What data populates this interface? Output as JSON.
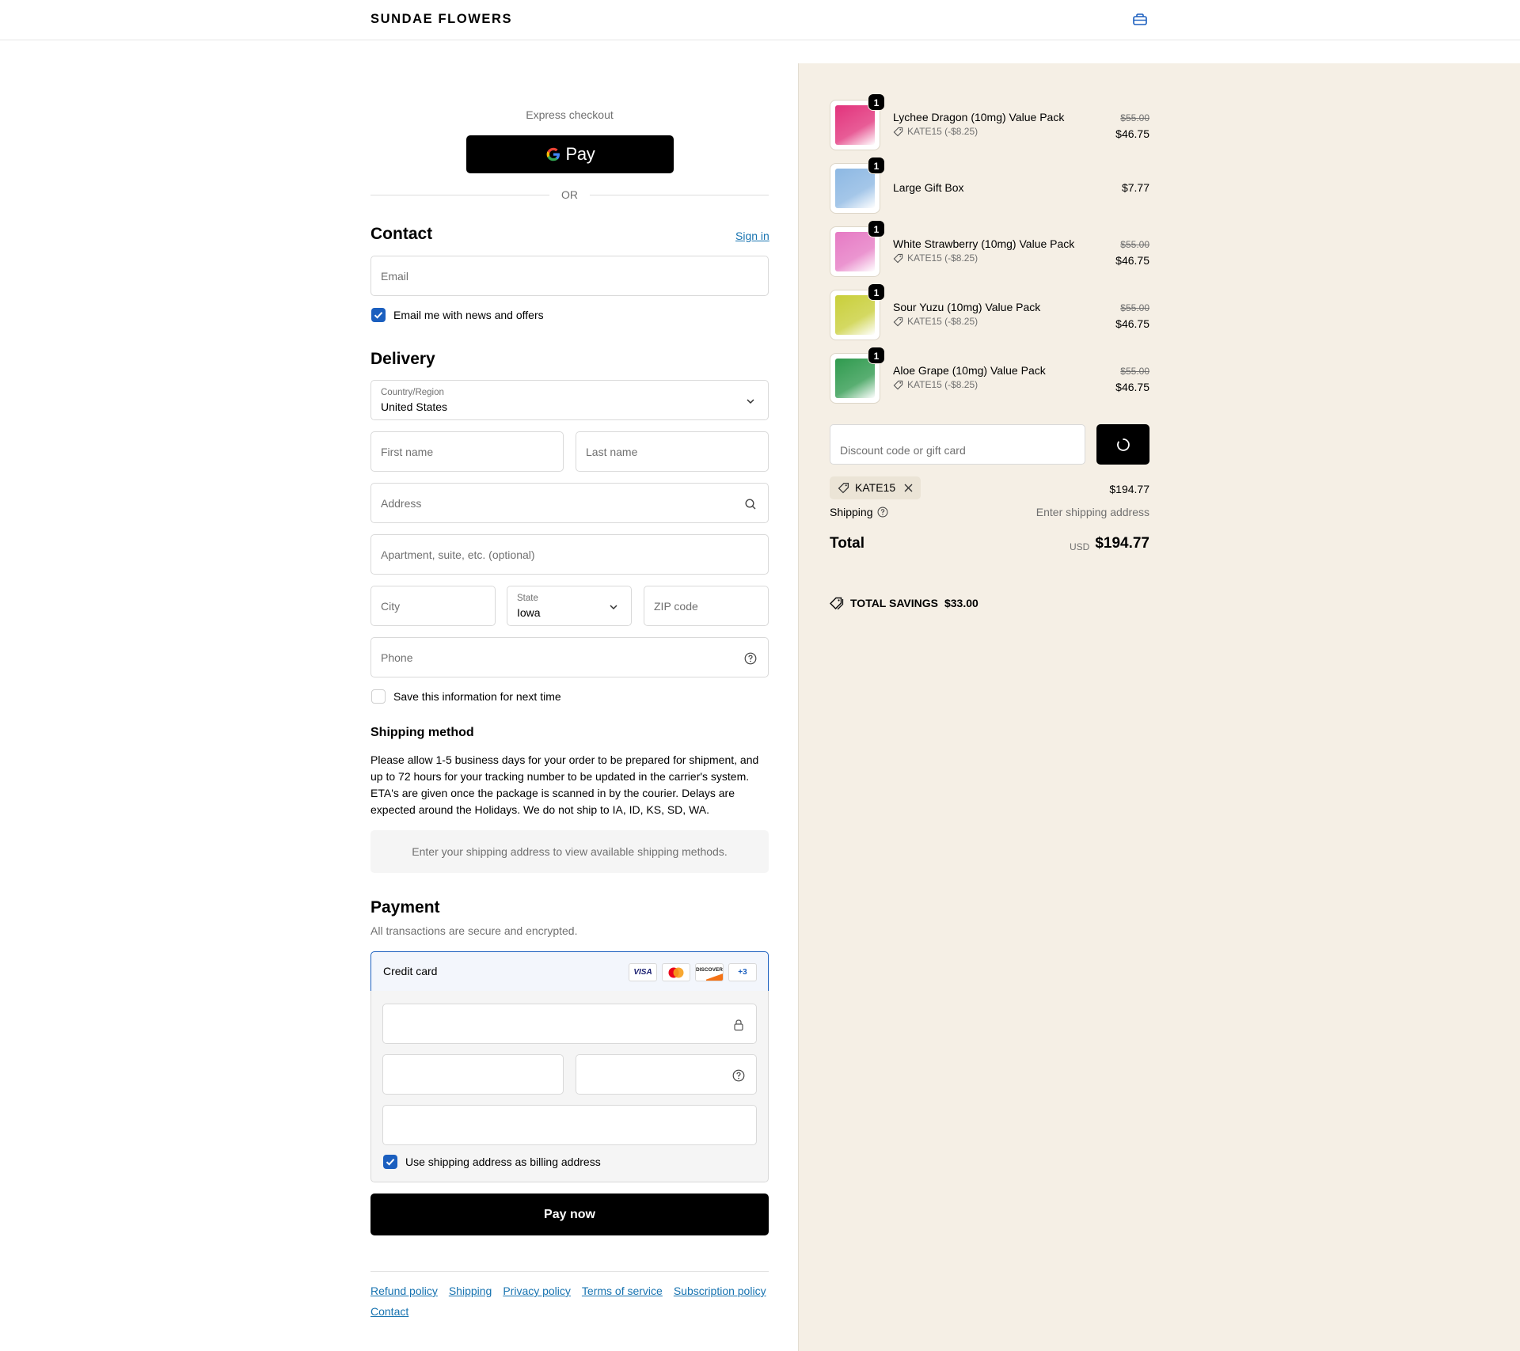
{
  "header": {
    "logo": "SUNDAE FLOWERS",
    "cart_icon": "bag-icon"
  },
  "express": {
    "label": "Express checkout",
    "gpay_label": "Pay",
    "or": "OR"
  },
  "contact": {
    "title": "Contact",
    "sign_in": "Sign in",
    "email_placeholder": "Email",
    "news_label": "Email me with news and offers",
    "news_checked": true
  },
  "delivery": {
    "title": "Delivery",
    "country_label": "Country/Region",
    "country_value": "United States",
    "first_name": "First name",
    "last_name": "Last name",
    "address": "Address",
    "apartment": "Apartment, suite, etc. (optional)",
    "city": "City",
    "state_label": "State",
    "state_value": "Iowa",
    "zip": "ZIP code",
    "phone": "Phone",
    "save_label": "Save this information for next time",
    "save_checked": false
  },
  "shipping_method": {
    "title": "Shipping method",
    "description": "Please allow 1-5 business days for your order to be prepared for shipment, and up to 72 hours for your tracking number to be updated in the carrier's system. ETA's are given once the package is scanned in by the courier. Delays are expected around the Holidays. We do not ship to IA, ID, KS, SD, WA.",
    "notice": "Enter your shipping address to view available shipping methods."
  },
  "payment": {
    "title": "Payment",
    "subtitle": "All transactions are secure and encrypted.",
    "method": "Credit card",
    "cards": [
      "VISA",
      "",
      "DISCOVER",
      "+3"
    ],
    "billing_label": "Use shipping address as billing address",
    "billing_checked": true,
    "pay_button": "Pay now"
  },
  "footer": {
    "links": [
      "Refund policy",
      "Shipping",
      "Privacy policy",
      "Terms of service",
      "Subscription policy",
      "Contact"
    ]
  },
  "summary": {
    "items": [
      {
        "name": "Lychee Dragon (10mg) Value Pack",
        "qty": "1",
        "discount": "KATE15 (-$8.25)",
        "old_price": "$55.00",
        "price": "$46.75",
        "color": "#e2337c"
      },
      {
        "name": "Large Gift Box",
        "qty": "1",
        "discount": "",
        "old_price": "",
        "price": "$7.77",
        "color": "#8db8e3"
      },
      {
        "name": "White Strawberry (10mg) Value Pack",
        "qty": "1",
        "discount": "KATE15 (-$8.25)",
        "old_price": "$55.00",
        "price": "$46.75",
        "color": "#e67ac4"
      },
      {
        "name": "Sour Yuzu (10mg) Value Pack",
        "qty": "1",
        "discount": "KATE15 (-$8.25)",
        "old_price": "$55.00",
        "price": "$46.75",
        "color": "#c9cf3a"
      },
      {
        "name": "Aloe Grape (10mg) Value Pack",
        "qty": "1",
        "discount": "KATE15 (-$8.25)",
        "old_price": "$55.00",
        "price": "$46.75",
        "color": "#2f9a4e"
      }
    ],
    "discount_placeholder": "Discount code or gift card",
    "applied_code": "KATE15",
    "subtotal": "$194.77",
    "shipping_label": "Shipping",
    "shipping_value": "Enter shipping address",
    "total_label": "Total",
    "currency": "USD",
    "total": "$194.77",
    "savings_label": "TOTAL SAVINGS",
    "savings_value": "$33.00"
  }
}
